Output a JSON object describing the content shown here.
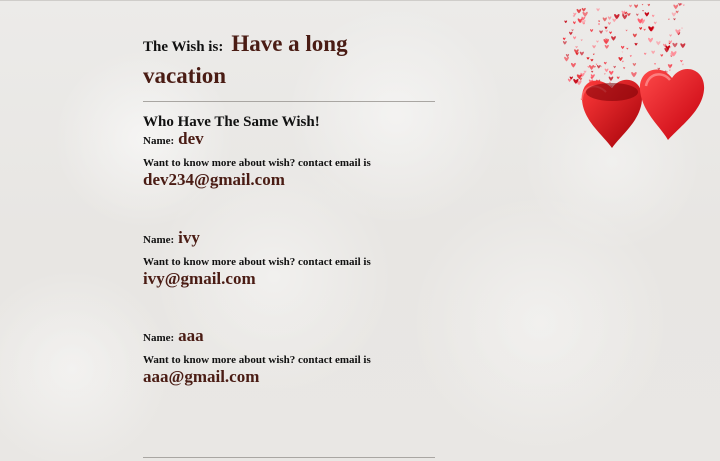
{
  "wish": {
    "prefix": "The Wish is:",
    "text": "Have a long vacation"
  },
  "same_wish_heading": "Who Have The Same Wish!",
  "people": [
    {
      "name_prefix": "Name:",
      "name": "dev",
      "contact_label": "Want to know more about wish? contact email is",
      "email": "dev234@gmail.com"
    },
    {
      "name_prefix": "Name:",
      "name": "ivy",
      "contact_label": "Want to know more about wish? contact email is",
      "email": "ivy@gmail.com"
    },
    {
      "name_prefix": "Name:",
      "name": "aaa",
      "contact_label": "Want to know more about wish? contact email is",
      "email": "aaa@gmail.com"
    }
  ],
  "decoration": {
    "icon": "heart-gift-box-icon",
    "accent_color": "#e0161c"
  },
  "colors": {
    "highlight_text": "#4a1c14",
    "body_text": "#111111"
  }
}
